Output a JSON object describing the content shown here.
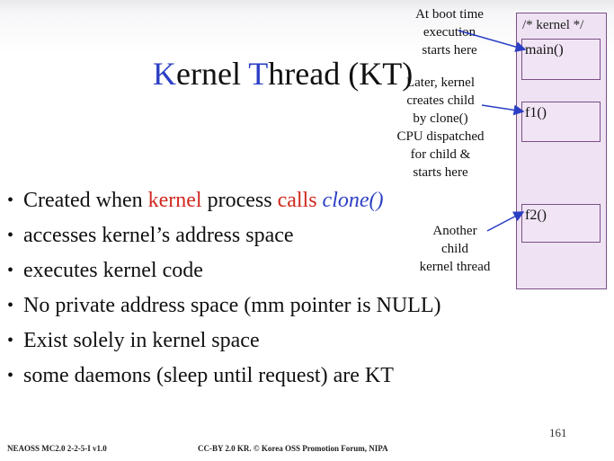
{
  "slide": {
    "title_k": "K",
    "title_ernel": "ernel ",
    "title_t": "T",
    "title_rest": "hread (KT)"
  },
  "bullets": [
    {
      "pre": "Created when ",
      "kernel": "kernel",
      "mid": " process ",
      "calls": "calls",
      "sp": " ",
      "clone": "clone()"
    },
    {
      "text": "accesses kernel’s address space"
    },
    {
      "text": "executes kernel code"
    },
    {
      "text": "No private address space (mm pointer is NULL)"
    },
    {
      "text": "Exist solely in kernel space"
    },
    {
      "text": "some daemons (sleep until request) are KT"
    }
  ],
  "notes": {
    "boot": [
      "At boot time",
      "execution",
      "starts here"
    ],
    "clone": [
      "Later, kernel",
      "creates child",
      "by clone()",
      "CPU dispatched",
      "for child &",
      "starts here"
    ],
    "another": [
      "Another",
      "child",
      "kernel thread"
    ]
  },
  "memory": {
    "header": "/* kernel */",
    "slots": [
      "main()",
      "f1()",
      "f2()"
    ]
  },
  "footer": {
    "page_number": "161",
    "left": "NEAOSS MC2.0 2-2-5-I v1.0",
    "center": "CC-BY 2.0 KR. © Korea OSS Promotion Forum, NIPA"
  },
  "colors": {
    "accent_blue": "#2b3fc4",
    "accent_red": "#d0281e",
    "memory_fill": "#efe3f3"
  }
}
